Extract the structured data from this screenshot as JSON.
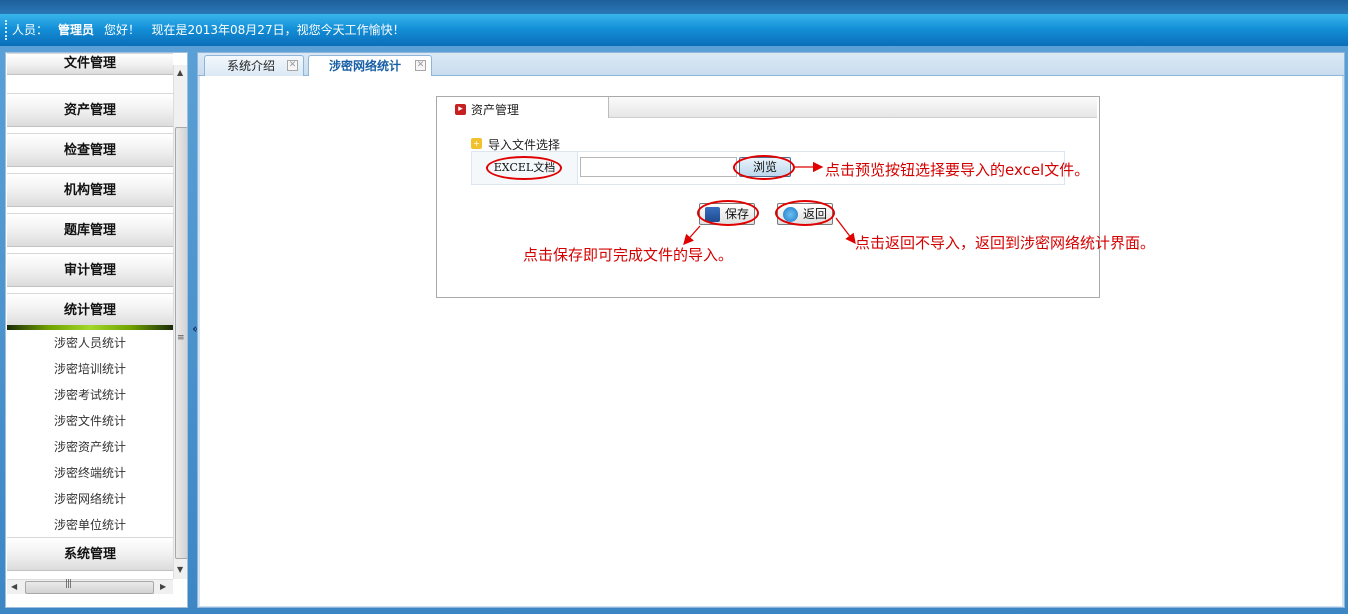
{
  "header": {
    "user_label": "人员：",
    "user_name": "管理员",
    "greeting": "您好！",
    "date_message": "现在是2013年08月27日，视您今天工作愉快！"
  },
  "sidebar": {
    "menus": [
      {
        "label": "文件管理"
      },
      {
        "label": "资产管理"
      },
      {
        "label": "检查管理"
      },
      {
        "label": "机构管理"
      },
      {
        "label": "题库管理"
      },
      {
        "label": "审计管理"
      },
      {
        "label": "统计管理"
      }
    ],
    "active_menu": "统计管理",
    "sub_items": [
      {
        "label": "涉密人员统计"
      },
      {
        "label": "涉密培训统计"
      },
      {
        "label": "涉密考试统计"
      },
      {
        "label": "涉密文件统计"
      },
      {
        "label": "涉密资产统计"
      },
      {
        "label": "涉密终端统计"
      },
      {
        "label": "涉密网络统计"
      },
      {
        "label": "涉密单位统计"
      }
    ],
    "bottom_menu": "系统管理",
    "collapse_glyph": "«"
  },
  "tabs": [
    {
      "label": "系统介绍",
      "active": false
    },
    {
      "label": "涉密网络统计",
      "active": true
    }
  ],
  "form": {
    "panel_title": "资产管理",
    "section_title": "导入文件选择",
    "file_label": "EXCEL文档",
    "file_value": "",
    "browse_label": "浏览",
    "save_label": "保存",
    "back_label": "返回"
  },
  "annotations": {
    "browse_note": "点击预览按钮选择要导入的excel文件。",
    "save_note": "点击保存即可完成文件的导入。",
    "back_note": "点击返回不导入，返回到涉密网络统计界面。",
    "color": "#e00000"
  },
  "colors": {
    "header_blue": "#1490d8",
    "active_tab_text": "#1a5fa5",
    "active_menu_bar": "#6fa000"
  }
}
